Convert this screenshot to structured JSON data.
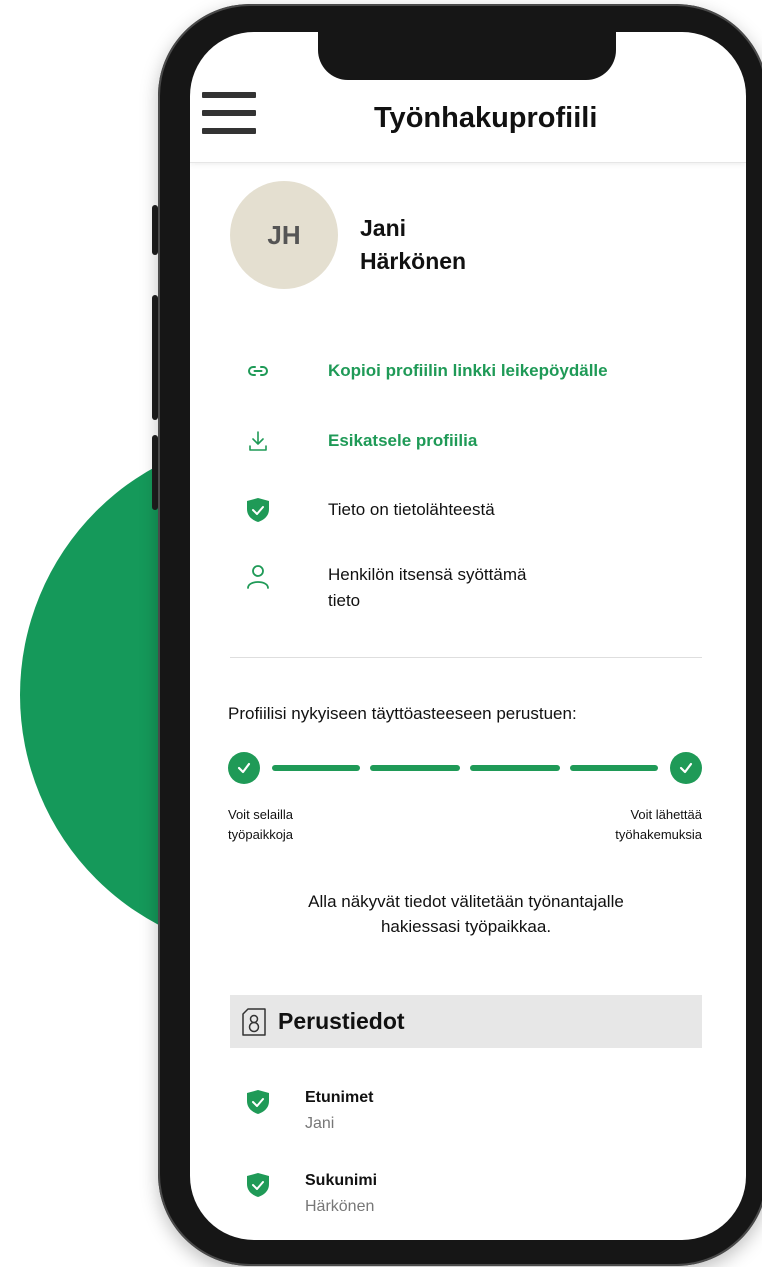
{
  "header": {
    "title": "Työnhakuprofiili",
    "menu_icon": "hamburger-menu-icon"
  },
  "profile": {
    "initials": "JH",
    "first_name": "Jani",
    "last_name": "Härkönen"
  },
  "actions": [
    {
      "icon": "link-icon",
      "label": "Kopioi profiilin linkki leikepöydälle"
    },
    {
      "icon": "download-icon",
      "label": "Esikatsele profiilia"
    }
  ],
  "legend": [
    {
      "icon": "shield-check-icon",
      "label": "Tieto on tietolähteestä"
    },
    {
      "icon": "person-icon",
      "label_line1": "Henkilön itsensä syöttämä",
      "label_line2": "tieto"
    }
  ],
  "progress": {
    "title": "Profiilisi nykyiseen täyttöasteeseen perustuen:",
    "completed_fraction": 1.0,
    "left_line1": "Voit selailla",
    "left_line2": "työpaikkoja",
    "right_line1": "Voit lähettää",
    "right_line2": "työhakemuksia"
  },
  "notice": {
    "line1": "Alla näkyvät tiedot välitetään työnantajalle",
    "line2": "hakiessasi työpaikkaa."
  },
  "section": {
    "icon": "id-card-icon",
    "title": "Perustiedot"
  },
  "fields": [
    {
      "label": "Etunimet",
      "value": "Jani"
    },
    {
      "label": "Sukunimi",
      "value": "Härkönen"
    }
  ],
  "colors": {
    "accent": "#1f9a57",
    "background_circle": "#15995a",
    "avatar_bg": "#e4dfd0",
    "section_bg": "#e7e7e7"
  }
}
